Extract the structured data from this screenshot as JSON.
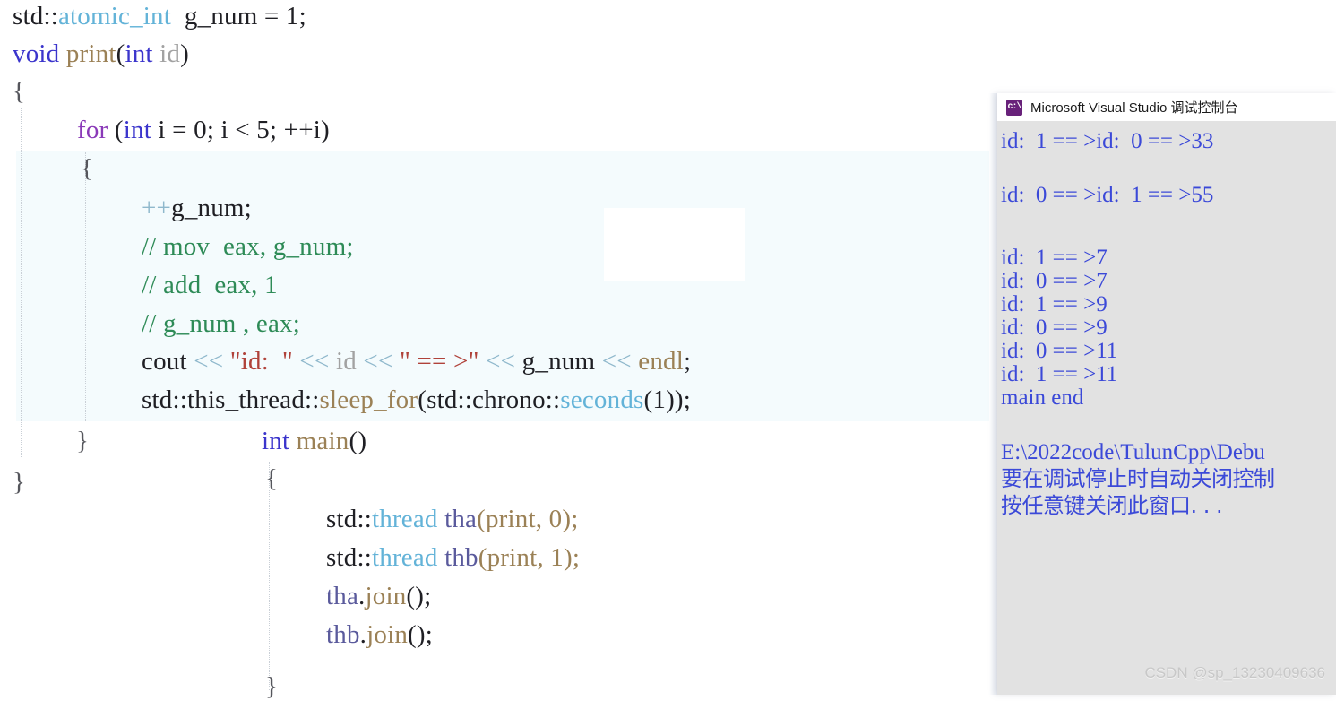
{
  "editor": {
    "background": "#ffffff",
    "block_highlight_color": "#f4fbfd",
    "indent_guide_color": "#c9cfd6",
    "lines": [
      {
        "id": "l1",
        "text": "std::atomic_int  g_num = 1;"
      },
      {
        "id": "l2",
        "text": "void print(int id)"
      },
      {
        "id": "l3",
        "text": "{"
      },
      {
        "id": "l4",
        "text": "for (int i = 0; i < 5; ++i)"
      },
      {
        "id": "l5",
        "text": "{"
      },
      {
        "id": "l6",
        "text": "++g_num;"
      },
      {
        "id": "l7",
        "text": "// mov  eax, g_num;"
      },
      {
        "id": "l8",
        "text": "// add  eax, 1"
      },
      {
        "id": "l9",
        "text": "// g_num , eax;"
      },
      {
        "id": "l10",
        "text": "cout << \"id:  \" << id << \" == >\" << g_num << endl;"
      },
      {
        "id": "l11",
        "text": "std::this_thread::sleep_for(std::chrono::seconds(1));"
      },
      {
        "id": "l12",
        "text": "}"
      },
      {
        "id": "l13",
        "text": "}"
      },
      {
        "id": "l14",
        "text": "int main()"
      },
      {
        "id": "l15",
        "text": "{"
      },
      {
        "id": "l16",
        "text": "std::thread tha(print, 0);"
      },
      {
        "id": "l17",
        "text": "std::thread thb(print, 1);"
      },
      {
        "id": "l18",
        "text": "tha.join();"
      },
      {
        "id": "l19",
        "text": "thb.join();"
      },
      {
        "id": "l20",
        "text": "}"
      }
    ],
    "tokens": {
      "std_prefix": "std::",
      "atomic_int": "atomic_int",
      "g_num_decl": "  g_num = 1;",
      "void": "void",
      "print": "print",
      "paren_open": "(",
      "int": "int",
      "id_param": " id",
      "paren_close": ")",
      "brace_open": "{",
      "brace_close": "}",
      "for": "for",
      "for_rest_a": " (",
      "for_rest_b": " i = 0; i < 5; ++i)",
      "inc_gnum": "++g_num;",
      "comment_mov": "// mov  eax, g_num;",
      "comment_add": "// add  eax, 1",
      "comment_gnum": "// g_num , eax;",
      "cout": "cout ",
      "shift": "<<",
      "str_id": "\"id:  \"",
      "id_var": " id ",
      "str_arrow": "\" == >\"",
      "g_num_var": " g_num ",
      "endl": " endl",
      "semi": ";",
      "this_thread": "std::this_thread::",
      "sleep_for": "sleep_for",
      "chrono": "(std::chrono::",
      "seconds": "seconds",
      "seconds_args": "(1));",
      "main": "main",
      "main_parens": "()",
      "thread": "thread",
      "tha": " tha",
      "thb": " thb",
      "thread_args_a": "(print, 0);",
      "thread_args_b": "(print, 1);",
      "tha_join": "tha",
      "thb_join": "thb",
      "dot": ".",
      "join": "join",
      "join_parens": "();"
    }
  },
  "console": {
    "title": "Microsoft Visual Studio 调试控制台",
    "icon": "console-app-icon",
    "icon_glyph": "c:\\",
    "icon_color": "#68217a",
    "background": "#e2e2e2",
    "text_color": "#3b49d8",
    "output": [
      {
        "id": "o1",
        "text": "id:  1 == >id:  0 == >33"
      },
      {
        "id": "o2",
        "text": "id:  0 == >id:  1 == >55"
      },
      {
        "id": "o3",
        "text": "id:  1 == >7"
      },
      {
        "id": "o4",
        "text": "id:  0 == >7"
      },
      {
        "id": "o5",
        "text": "id:  1 == >9"
      },
      {
        "id": "o6",
        "text": "id:  0 == >9"
      },
      {
        "id": "o7",
        "text": "id:  0 == >11"
      },
      {
        "id": "o8",
        "text": "id:  1 == >11"
      },
      {
        "id": "o9",
        "text": "main end"
      },
      {
        "id": "o10",
        "text": "E:\\2022code\\TulunCpp\\Debu"
      },
      {
        "id": "o11",
        "text": "要在调试停止时自动关闭控制"
      },
      {
        "id": "o12",
        "text": "按任意键关闭此窗口. . ."
      }
    ]
  },
  "watermark": {
    "text": "CSDN @sp_13230409636"
  }
}
